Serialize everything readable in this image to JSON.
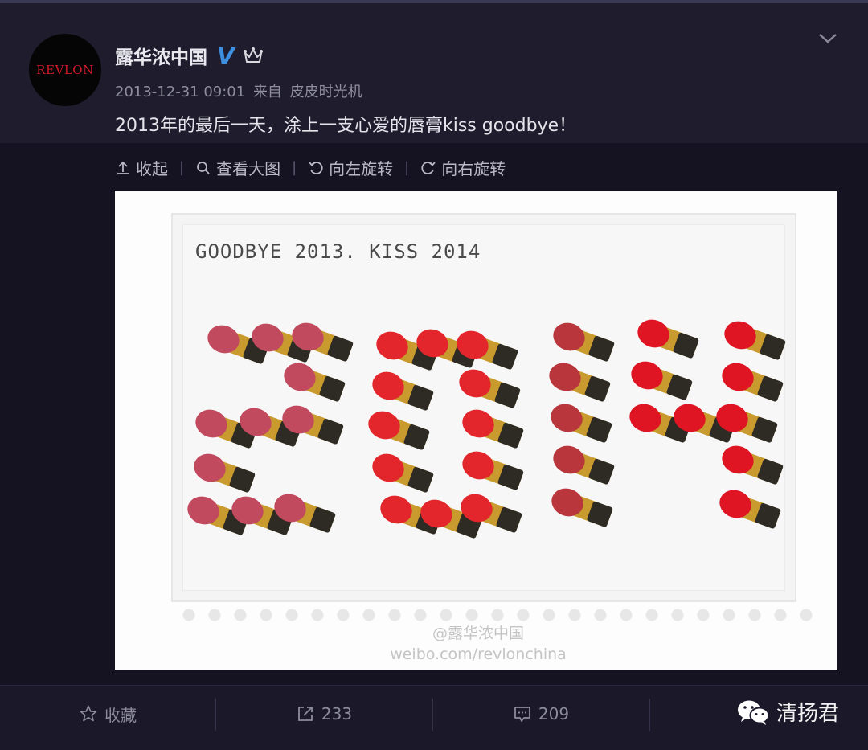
{
  "post": {
    "avatar_text": "REVLON",
    "user_name": "露华浓中国",
    "verified_mark": "V",
    "timestamp": "2013-12-31 09:01",
    "source_prefix": "来自",
    "source": "皮皮时光机",
    "text": "2013年的最后一天，涂上一支心爱的唇膏kiss goodbye！"
  },
  "toolbar": {
    "collapse": "收起",
    "view_large": "查看大图",
    "rotate_left": "向左旋转",
    "rotate_right": "向右旋转",
    "separator": "|"
  },
  "image": {
    "caption": "GOODBYE 2013. KISS 2014",
    "watermark_line1": "@露华浓中国",
    "watermark_line2": "weibo.com/revlonchina"
  },
  "actions": {
    "favorite": "收藏",
    "repost_count": "233",
    "comment_count": "209"
  },
  "badge": {
    "text": "清扬君"
  },
  "icons": [
    "crown-icon",
    "chevron-down-icon",
    "collapse-icon",
    "search-icon",
    "rotate-left-icon",
    "rotate-right-icon",
    "star-icon",
    "repost-icon",
    "comment-icon",
    "wechat-icon"
  ]
}
